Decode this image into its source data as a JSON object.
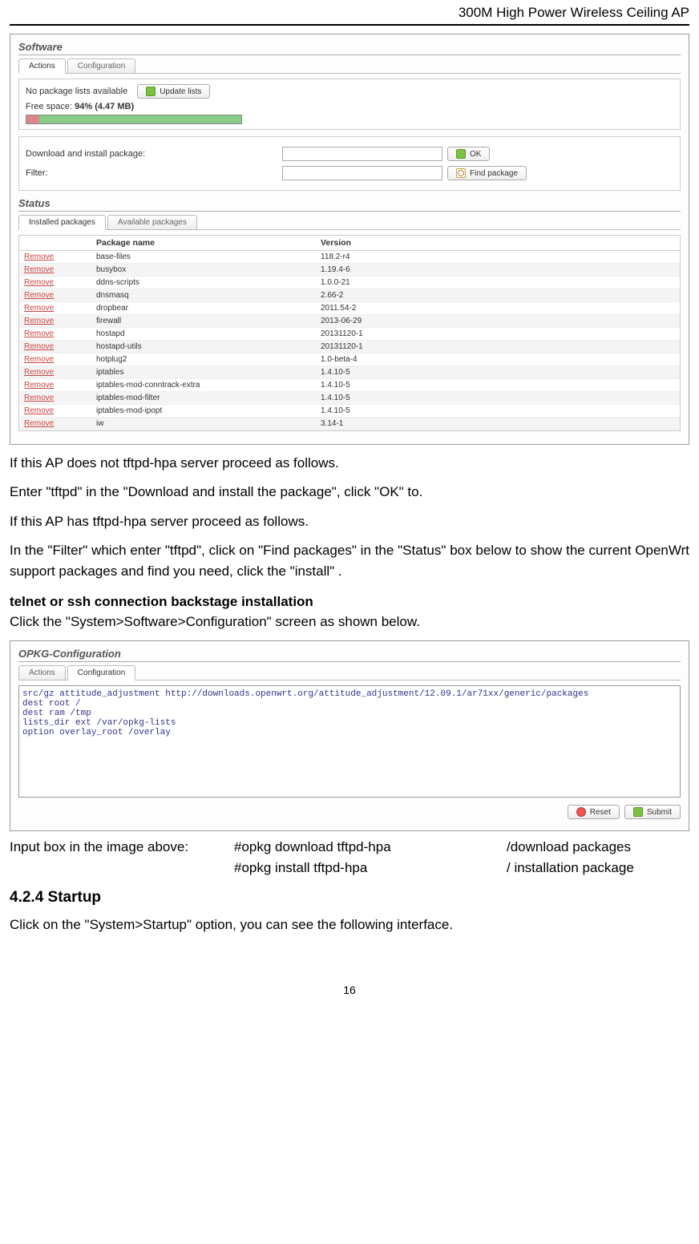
{
  "header": {
    "title": "300M High Power Wireless Ceiling AP"
  },
  "software": {
    "title": "Software",
    "tabs": {
      "actions": "Actions",
      "configuration": "Configuration"
    },
    "no_lists": "No package lists available",
    "update_lists_btn": "Update lists",
    "free_space_label": "Free space: ",
    "free_space_value": "94% (4.47 MB)",
    "download_label": "Download and install package:",
    "ok_btn": "OK",
    "filter_label": "Filter:",
    "find_btn": "Find package"
  },
  "status": {
    "title": "Status",
    "tabs": {
      "installed": "Installed packages",
      "available": "Available packages"
    },
    "col_remove": "",
    "col_name": "Package name",
    "col_version": "Version",
    "remove_label": "Remove",
    "packages": [
      {
        "name": "base-files",
        "version": "118.2-r4"
      },
      {
        "name": "busybox",
        "version": "1.19.4-6"
      },
      {
        "name": "ddns-scripts",
        "version": "1.0.0-21"
      },
      {
        "name": "dnsmasq",
        "version": "2.66-2"
      },
      {
        "name": "dropbear",
        "version": "2011.54-2"
      },
      {
        "name": "firewall",
        "version": "2013-06-29"
      },
      {
        "name": "hostapd",
        "version": "20131120-1"
      },
      {
        "name": "hostapd-utils",
        "version": "20131120-1"
      },
      {
        "name": "hotplug2",
        "version": "1.0-beta-4"
      },
      {
        "name": "iptables",
        "version": "1.4.10-5"
      },
      {
        "name": "iptables-mod-conntrack-extra",
        "version": "1.4.10-5"
      },
      {
        "name": "iptables-mod-filter",
        "version": "1.4.10-5"
      },
      {
        "name": "iptables-mod-ipopt",
        "version": "1.4.10-5"
      },
      {
        "name": "iw",
        "version": "3.14-1"
      }
    ]
  },
  "text": {
    "p1": "If this AP does not tftpd-hpa server proceed as follows.",
    "p2": "Enter \"tftpd\" in the \"Download and install the package\", click \"OK\" to.",
    "p3": "If this AP has tftpd-hpa server proceed as follows.",
    "p4": "In the \"Filter\" which enter \"tftpd\", click on \"Find packages\" in the \"Status\" box below to show the current OpenWrt support packages and find you need, click the \"install\" .",
    "h1": "telnet or ssh connection backstage installation",
    "p5": "Click the \"System>Software>Configuration\" screen as shown below."
  },
  "opkg": {
    "title": "OPKG-Configuration",
    "tabs": {
      "actions": "Actions",
      "configuration": "Configuration"
    },
    "config_text": "src/gz attitude_adjustment http://downloads.openwrt.org/attitude_adjustment/12.09.1/ar71xx/generic/packages\ndest root /\ndest ram /tmp\nlists_dir ext /var/opkg-lists\noption overlay_root /overlay",
    "reset_btn": "Reset",
    "submit_btn": "Submit"
  },
  "cmds": {
    "intro": "Input box in the image above: ",
    "l1a": "#opkg download tftpd-hpa",
    "l1b": "/download packages",
    "l2a": "#opkg install tftpd-hpa",
    "l2b": "/ installation package"
  },
  "startup": {
    "heading": "4.2.4 Startup",
    "p": "Click on the \"System>Startup\" option, you can see the following interface."
  },
  "pagenum": "16"
}
